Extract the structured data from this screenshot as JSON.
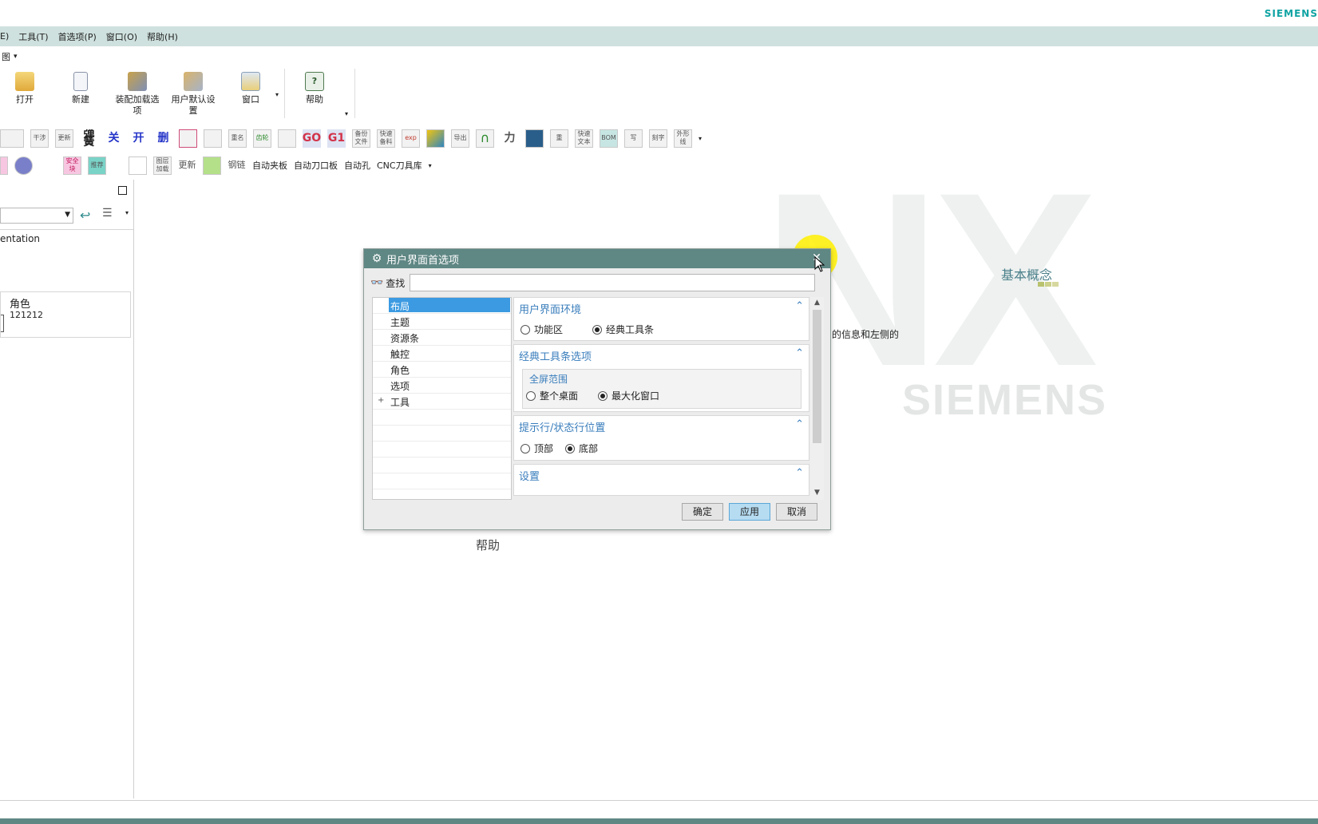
{
  "header": {
    "brand": "SIEMENS"
  },
  "menu": {
    "items": [
      "E)",
      "工具(T)",
      "首选项(P)",
      "窗口(O)",
      "帮助(H)"
    ]
  },
  "ribbon_tab": {
    "label": "图"
  },
  "ribbon": {
    "buttons": [
      {
        "label": "打开",
        "icon": "open-folder-icon"
      },
      {
        "label": "新建",
        "icon": "new-file-icon"
      },
      {
        "label": "装配加载选项",
        "icon": "assembly-load-icon"
      },
      {
        "label": "用户默认设置",
        "icon": "user-defaults-icon"
      },
      {
        "label": "窗口",
        "icon": "window-icon"
      },
      {
        "label": "帮助",
        "icon": "help-icon"
      }
    ]
  },
  "toolbar1": {
    "items": [
      "干涉",
      "更新",
      "弹簧",
      "关",
      "开",
      "删",
      "重名",
      "齿轮",
      "GO",
      "G1",
      "备份文件",
      "快速备料",
      "exp",
      "导出",
      "力",
      "重",
      "快速文本",
      "BOM",
      "写",
      "刻字",
      "外形线"
    ]
  },
  "toolbar2": {
    "items": [
      "安全块",
      "推荐",
      "图层加载",
      "更新",
      "钢链"
    ],
    "text_buttons": [
      "自动夹板",
      "自动刀口板",
      "自动孔",
      "CNC刀具库"
    ]
  },
  "left_panel": {
    "entry": "entation",
    "role_title": "角色",
    "role_value": "121212"
  },
  "background": {
    "watermark_nx": "NX",
    "watermark_siemens": "SIEMENS",
    "basic_concept": "基本概念",
    "info_text": "的信息和左侧的",
    "help_text": "帮助"
  },
  "dialog": {
    "title": "用户界面首选项",
    "search_label": "查找",
    "search_value": "",
    "tree": [
      {
        "label": "布局",
        "selected": true,
        "expandable": false
      },
      {
        "label": "主题",
        "selected": false,
        "expandable": false
      },
      {
        "label": "资源条",
        "selected": false,
        "expandable": false
      },
      {
        "label": "触控",
        "selected": false,
        "expandable": false
      },
      {
        "label": "角色",
        "selected": false,
        "expandable": false
      },
      {
        "label": "选项",
        "selected": false,
        "expandable": false
      },
      {
        "label": "工具",
        "selected": false,
        "expandable": true
      }
    ],
    "groups": {
      "env": {
        "title": "用户界面环境",
        "options": [
          {
            "label": "功能区",
            "checked": false
          },
          {
            "label": "经典工具条",
            "checked": true
          }
        ]
      },
      "classic": {
        "title": "经典工具条选项",
        "sub_title": "全屏范围",
        "options": [
          {
            "label": "整个桌面",
            "checked": false
          },
          {
            "label": "最大化窗口",
            "checked": true
          }
        ]
      },
      "prompt": {
        "title": "提示行/状态行位置",
        "options": [
          {
            "label": "顶部",
            "checked": false
          },
          {
            "label": "底部",
            "checked": true
          }
        ]
      },
      "settings": {
        "title": "设置"
      }
    },
    "buttons": {
      "ok": "确定",
      "apply": "应用",
      "cancel": "取消"
    }
  },
  "colors": {
    "accent": "#5f8784",
    "menubar": "#cfe1de",
    "link_blue": "#3a7ebc",
    "selection": "#3b9ae1"
  }
}
